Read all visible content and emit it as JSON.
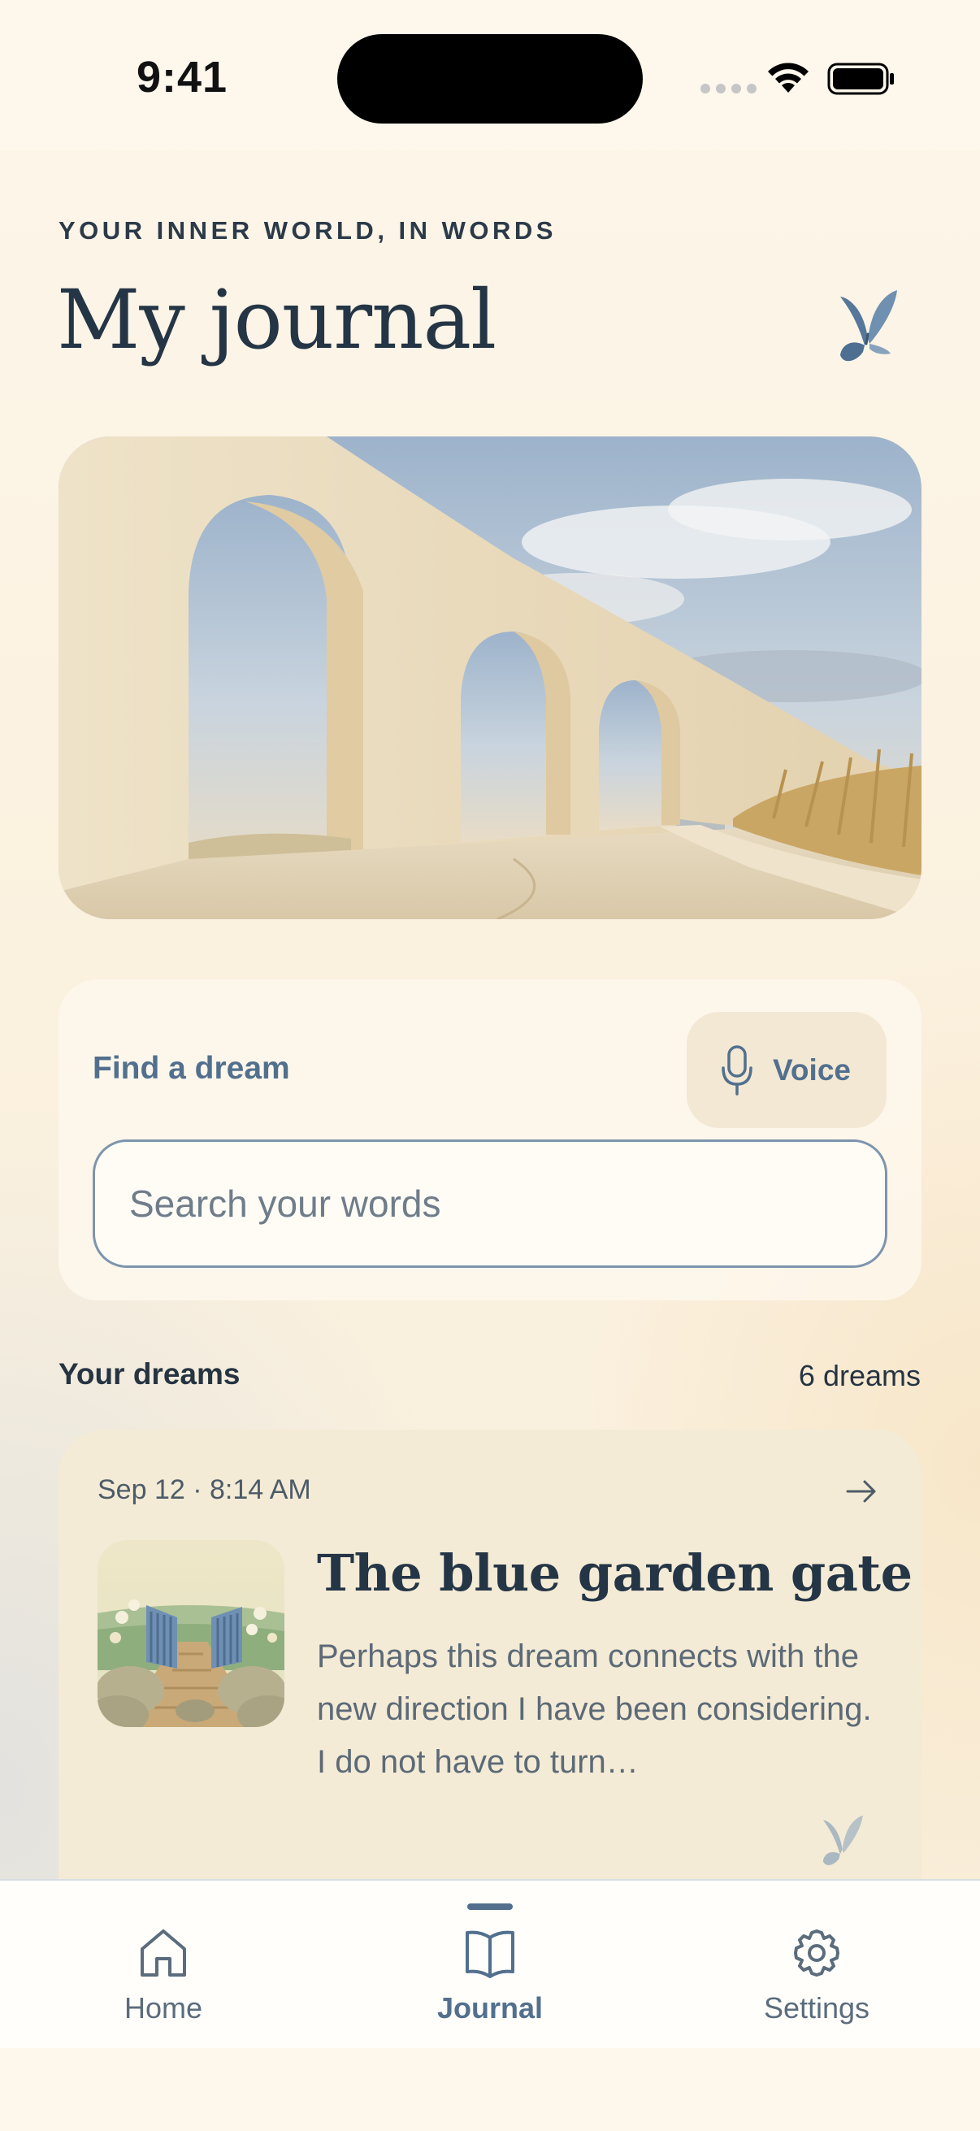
{
  "status_bar": {
    "time": "9:41"
  },
  "header": {
    "eyebrow": "YOUR INNER WORLD, IN WORDS",
    "title": "My journal",
    "icon": "butterfly-icon"
  },
  "search": {
    "label": "Find a dream",
    "voice_label": "Voice",
    "placeholder": "Search your words",
    "value": ""
  },
  "dreams_section": {
    "title": "Your dreams",
    "count": "6 dreams"
  },
  "dreams": [
    {
      "date": "Sep 12 · 8:14 AM",
      "title": "The blue garden gate",
      "excerpt": "Perhaps this dream connects with the new direction I have been considering. I do not have to turn…"
    }
  ],
  "tab_bar": {
    "tabs": [
      {
        "label": "Home",
        "icon": "home-icon",
        "active": false
      },
      {
        "label": "Journal",
        "icon": "book-icon",
        "active": true
      },
      {
        "label": "Settings",
        "icon": "gear-icon",
        "active": false
      }
    ]
  },
  "colors": {
    "accent": "#52708e",
    "background": "#fbf3e4",
    "card": "#f4ebd6",
    "text": "#263442"
  }
}
